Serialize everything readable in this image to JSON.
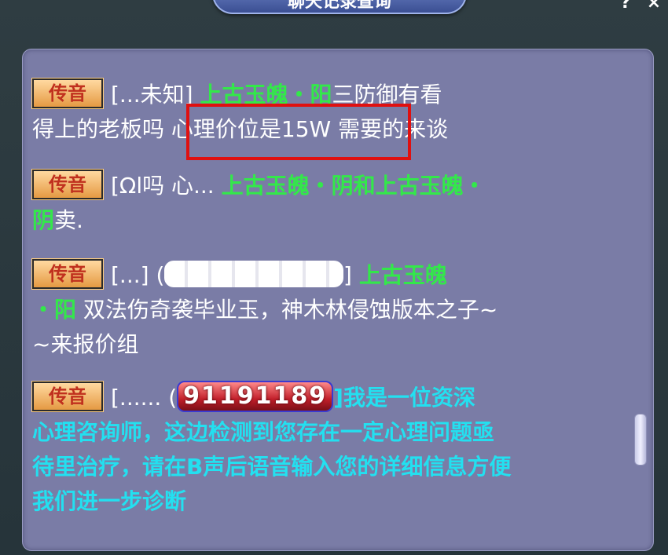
{
  "window": {
    "title": "聊天记录查询",
    "help_label": "?",
    "close_label": "×"
  },
  "messages": [
    {
      "badge": "传音",
      "sender": "[...未知",
      "item": "上古玉魄・阳",
      "text_line1": "三防御有看",
      "text_line2": "得上的老板吗 心理价位是15W 需要的来谈"
    },
    {
      "badge": "传音",
      "sender": "[Ωl吗 心...",
      "item_line1": "上古玉魄・阴和上古玉魄・",
      "item_line2": "阴",
      "text": "卖."
    },
    {
      "badge": "传音",
      "sender": "[...]",
      "blurred": "□□□□□□□□",
      "item_line1": "上古玉魄",
      "item_line2": "・阳",
      "text_line1": "双法伤奇袭毕业玉，神木林侵蚀版本之子~",
      "text_line2": "~来报价组"
    },
    {
      "badge": "传音",
      "sender": "[......",
      "number_tag": "91191189",
      "text_line1": "]我是一位资深",
      "text_line2": "心理咨询师，这边检测到您存在一定心理问题亟",
      "text_line3": "待里治疗，请在B声后语音输入您的详细信息方便",
      "text_line4": "我们进一步诊断"
    }
  ],
  "colors": {
    "panel_bg": "#7a7ca6",
    "item_green": "#33e84a",
    "system_cyan": "#23e0f0",
    "highlight_red": "#e01010"
  }
}
